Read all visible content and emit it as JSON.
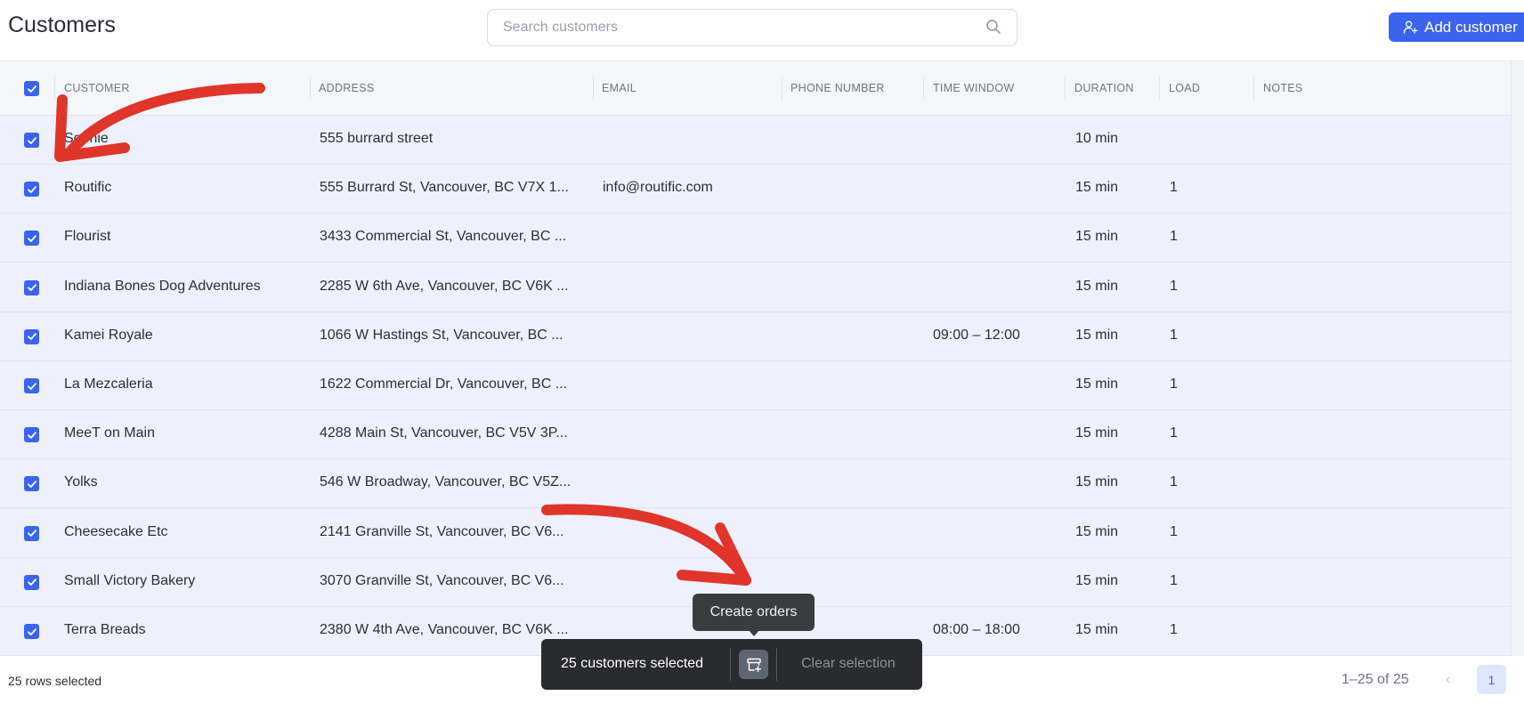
{
  "header": {
    "title": "Customers",
    "search_placeholder": "Search customers",
    "add_label": "Add customer"
  },
  "columns": [
    "CUSTOMER",
    "ADDRESS",
    "EMAIL",
    "PHONE NUMBER",
    "TIME WINDOW",
    "DURATION",
    "LOAD",
    "NOTES"
  ],
  "rows": [
    {
      "customer": "Sophie",
      "address": "555 burrard street",
      "email": "",
      "phone": "",
      "time_window": "",
      "duration": "10 min",
      "load": "",
      "notes": ""
    },
    {
      "customer": "Routific",
      "address": "555 Burrard St, Vancouver, BC V7X 1...",
      "email": "info@routific.com",
      "phone": "",
      "time_window": "",
      "duration": "15 min",
      "load": "1",
      "notes": ""
    },
    {
      "customer": "Flourist",
      "address": "3433 Commercial St, Vancouver, BC ...",
      "email": "",
      "phone": "",
      "time_window": "",
      "duration": "15 min",
      "load": "1",
      "notes": ""
    },
    {
      "customer": "Indiana Bones Dog Adventures",
      "address": "2285 W 6th Ave, Vancouver, BC V6K ...",
      "email": "",
      "phone": "",
      "time_window": "",
      "duration": "15 min",
      "load": "1",
      "notes": ""
    },
    {
      "customer": "Kamei Royale",
      "address": "1066 W Hastings St, Vancouver, BC ...",
      "email": "",
      "phone": "",
      "time_window": "09:00 – 12:00",
      "duration": "15 min",
      "load": "1",
      "notes": ""
    },
    {
      "customer": "La Mezcaleria",
      "address": "1622 Commercial Dr, Vancouver, BC ...",
      "email": "",
      "phone": "",
      "time_window": "",
      "duration": "15 min",
      "load": "1",
      "notes": ""
    },
    {
      "customer": "MeeT on Main",
      "address": "4288 Main St, Vancouver, BC V5V 3P...",
      "email": "",
      "phone": "",
      "time_window": "",
      "duration": "15 min",
      "load": "1",
      "notes": ""
    },
    {
      "customer": "Yolks",
      "address": "546 W Broadway, Vancouver, BC V5Z...",
      "email": "",
      "phone": "",
      "time_window": "",
      "duration": "15 min",
      "load": "1",
      "notes": ""
    },
    {
      "customer": "Cheesecake Etc",
      "address": "2141 Granville St, Vancouver, BC V6...",
      "email": "",
      "phone": "",
      "time_window": "",
      "duration": "15 min",
      "load": "1",
      "notes": ""
    },
    {
      "customer": "Small Victory Bakery",
      "address": "3070 Granville St, Vancouver, BC V6...",
      "email": "",
      "phone": "",
      "time_window": "",
      "duration": "15 min",
      "load": "1",
      "notes": ""
    },
    {
      "customer": "Terra Breads",
      "address": "2380 W 4th Ave, Vancouver, BC V6K ...",
      "email": "",
      "phone": "",
      "time_window": "08:00 – 18:00",
      "duration": "15 min",
      "load": "1",
      "notes": ""
    }
  ],
  "footer": {
    "rows_selected": "25 rows selected",
    "range": "1–25 of 25",
    "prev": "‹",
    "page": "1"
  },
  "action_bar": {
    "count": "25 customers selected",
    "clear": "Clear selection",
    "tooltip": "Create orders"
  },
  "colors": {
    "accent": "#3b63f0",
    "row_selected_bg": "#eef1fb",
    "annotation_arrow": "#e0352b",
    "action_bar_bg": "#2a2b2e"
  },
  "icons": {
    "search": "search-icon",
    "add": "user-plus-icon",
    "check": "check-icon",
    "create": "create-orders-icon"
  }
}
